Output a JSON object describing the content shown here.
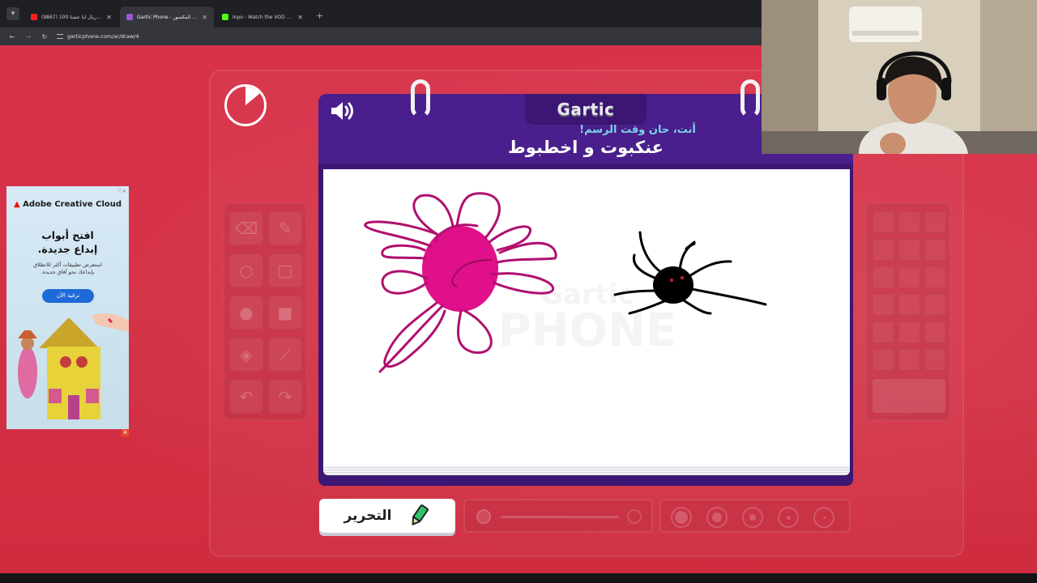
{
  "browser": {
    "tabs": [
      {
        "title": "(9867) مليون ريال لنا عشنا 100 ...",
        "active": false,
        "favicon_color": "#ff1e1e"
      },
      {
        "title": "Gartic Phone - الهاتف المكسور",
        "active": true,
        "favicon_color": "#9b59d0"
      },
      {
        "title": "Inpo - Watch the VOD on Kick",
        "active": false,
        "favicon_color": "#53fc18"
      }
    ],
    "new_tab": "+",
    "url": "garticphone.com/ar/draw/4"
  },
  "game": {
    "logo": "Gartic",
    "prompt_subtitle": "أنت، حان وقت الرسم!",
    "prompt_word": "عنكبوت و اخطبوط",
    "watermark_top": "Gartic",
    "watermark_bottom": "PHONE",
    "edit_button_label": "التحرير",
    "timer_elapsed_fraction": 0.14,
    "colors": {
      "primary_purple": "#4a1e8c",
      "flower_pink": "#e0108a",
      "flower_outline": "#b0106e",
      "spider": "#000000"
    }
  },
  "ad": {
    "brand": "Adobe Creative Cloud",
    "brand_accent": "Adobe",
    "headline_line1": "افتح أبواب",
    "headline_line2": "إبداع جديدة.",
    "body_line1": "استعرض تطبيقات أكثر للانطلاق",
    "body_line2": "بإبداعك نحو آفاق جديدة.",
    "cta": "ترقية الآن"
  }
}
